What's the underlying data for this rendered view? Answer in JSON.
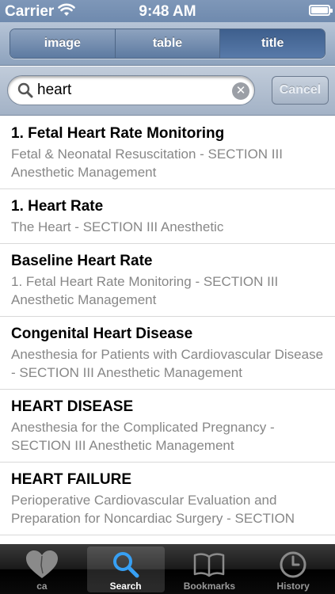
{
  "status_bar": {
    "carrier": "Carrier",
    "time": "9:48 AM"
  },
  "segments": [
    {
      "label": "image"
    },
    {
      "label": "table"
    },
    {
      "label": "title",
      "selected": true
    }
  ],
  "search": {
    "value": "heart",
    "placeholder": "",
    "cancel_label": "Cancel"
  },
  "results": [
    {
      "title": "1. Fetal Heart Rate Monitoring",
      "subtitle": "Fetal & Neonatal Resuscitation - SECTION III Anesthetic Management"
    },
    {
      "title": "1. Heart Rate",
      "subtitle": "The Heart - SECTION III Anesthetic"
    },
    {
      "title": "Baseline Heart Rate",
      "subtitle": "1. Fetal Heart Rate Monitoring - SECTION III Anesthetic Management"
    },
    {
      "title": "Congenital Heart Disease",
      "subtitle": "Anesthesia for Patients with Cardiovascular Disease - SECTION III Anesthetic Management"
    },
    {
      "title": "HEART DISEASE",
      "subtitle": "Anesthesia for the Complicated Pregnancy - SECTION III Anesthetic Management"
    },
    {
      "title": "HEART FAILURE",
      "subtitle": "Perioperative Cardiovascular Evaluation and Preparation for Noncardiac Surgery - SECTION"
    }
  ],
  "tab_bar": {
    "tabs": [
      {
        "label": "ca",
        "icon": "heart-icon"
      },
      {
        "label": "Search",
        "icon": "search-icon",
        "active": true
      },
      {
        "label": "Bookmarks",
        "icon": "book-icon"
      },
      {
        "label": "History",
        "icon": "clock-icon"
      }
    ]
  },
  "colors": {
    "accent_search_icon": "#2f8fe6",
    "subtitle_text": "#878787"
  }
}
